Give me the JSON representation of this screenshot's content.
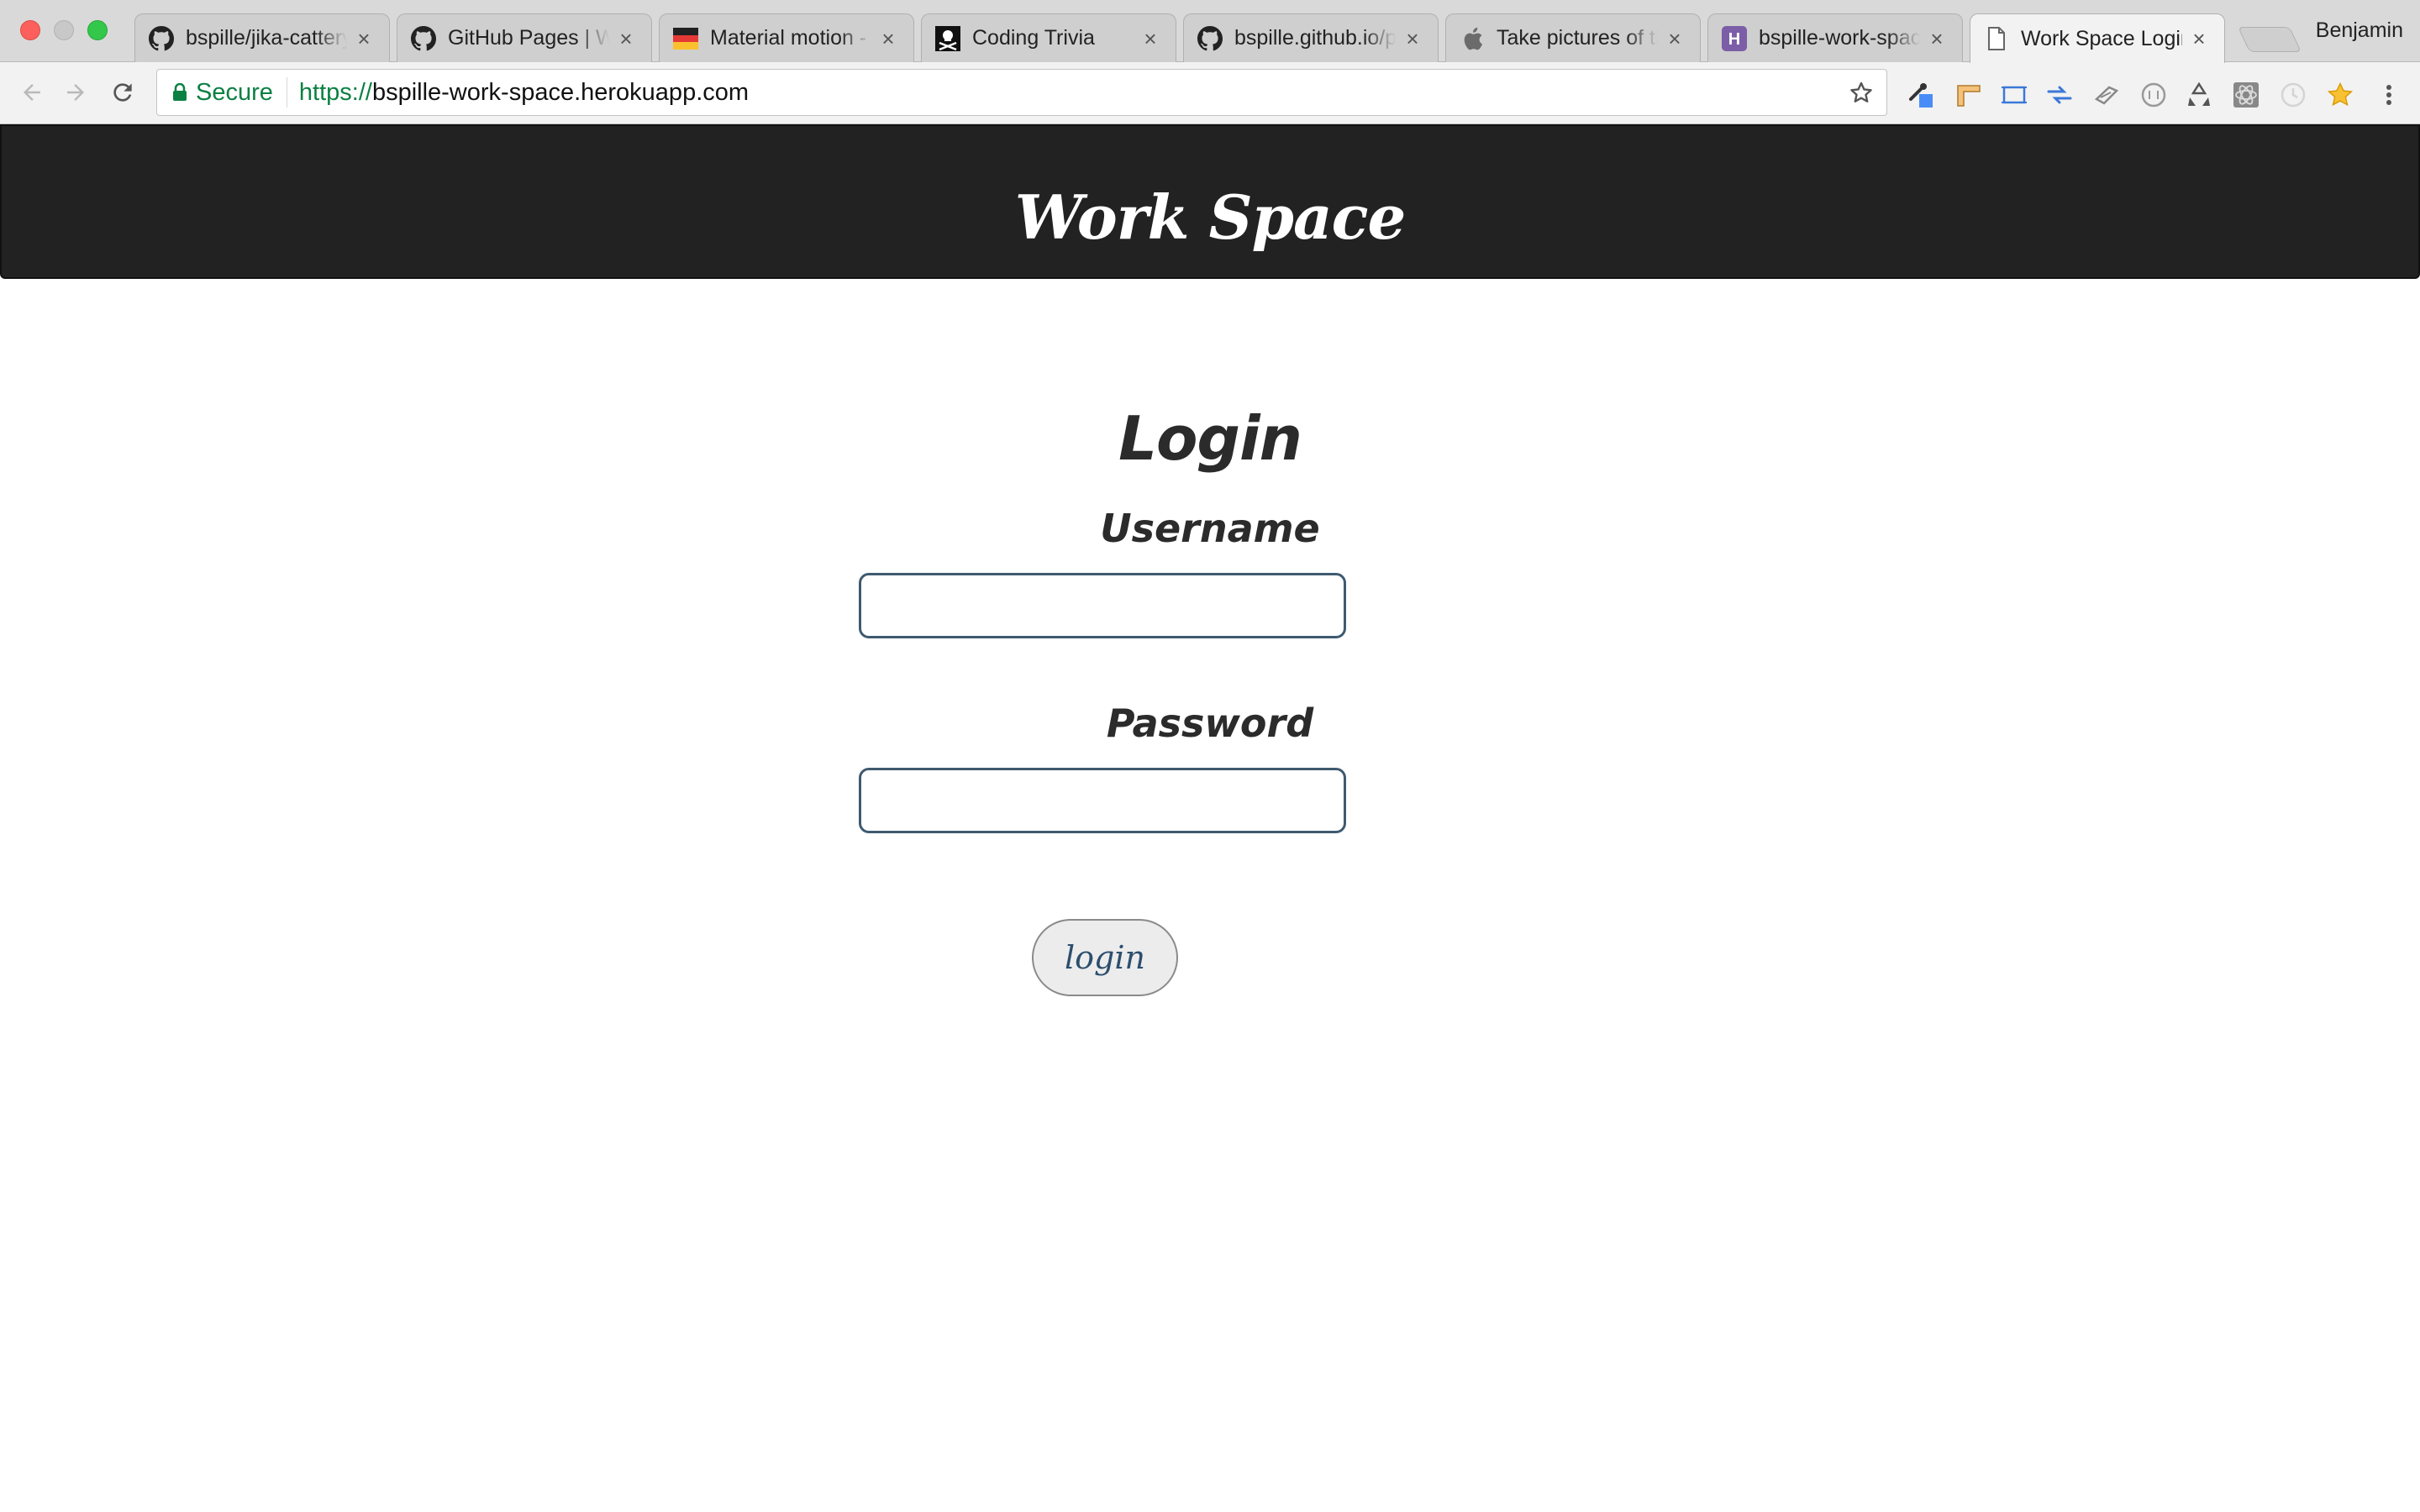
{
  "browser": {
    "tabs": [
      {
        "title": "bspille/jika-cattery",
        "favicon": "github-icon",
        "active": false
      },
      {
        "title": "GitHub Pages | Websites",
        "favicon": "github-icon",
        "active": false
      },
      {
        "title": "Material motion - Motion",
        "favicon": "material-icon",
        "active": false
      },
      {
        "title": "Coding Trivia",
        "favicon": "pirate-flag-icon",
        "active": false
      },
      {
        "title": "bspille.github.io/portfolio",
        "favicon": "github-icon",
        "active": false
      },
      {
        "title": "Take pictures of the screen",
        "favicon": "apple-icon",
        "active": false
      },
      {
        "title": "bspille-work-space",
        "favicon": "heroku-icon",
        "active": false
      },
      {
        "title": "Work Space Login",
        "favicon": "page-icon",
        "active": true
      }
    ],
    "tab_close_symbol": "×",
    "profile_name": "Benjamin",
    "omnibox": {
      "secure_label": "Secure",
      "url_scheme": "https://",
      "url_host": "bspille-work-space.herokuapp.com"
    },
    "extensions": [
      "eyedropper-icon",
      "ruler-icon",
      "screenshot-icon",
      "arrows-icon",
      "link-icon",
      "circle-icon",
      "recycle-icon",
      "react-icon",
      "clock-icon",
      "star-extension-icon"
    ]
  },
  "page": {
    "site_title": "Work Space",
    "login": {
      "heading": "Login",
      "username_label": "Username",
      "username_value": "",
      "password_label": "Password",
      "password_value": "",
      "submit_label": "login"
    }
  },
  "colors": {
    "header_bg": "#222222",
    "input_border": "#3f5a70",
    "secure_green": "#0b8043",
    "button_text": "#2c4e6e"
  }
}
